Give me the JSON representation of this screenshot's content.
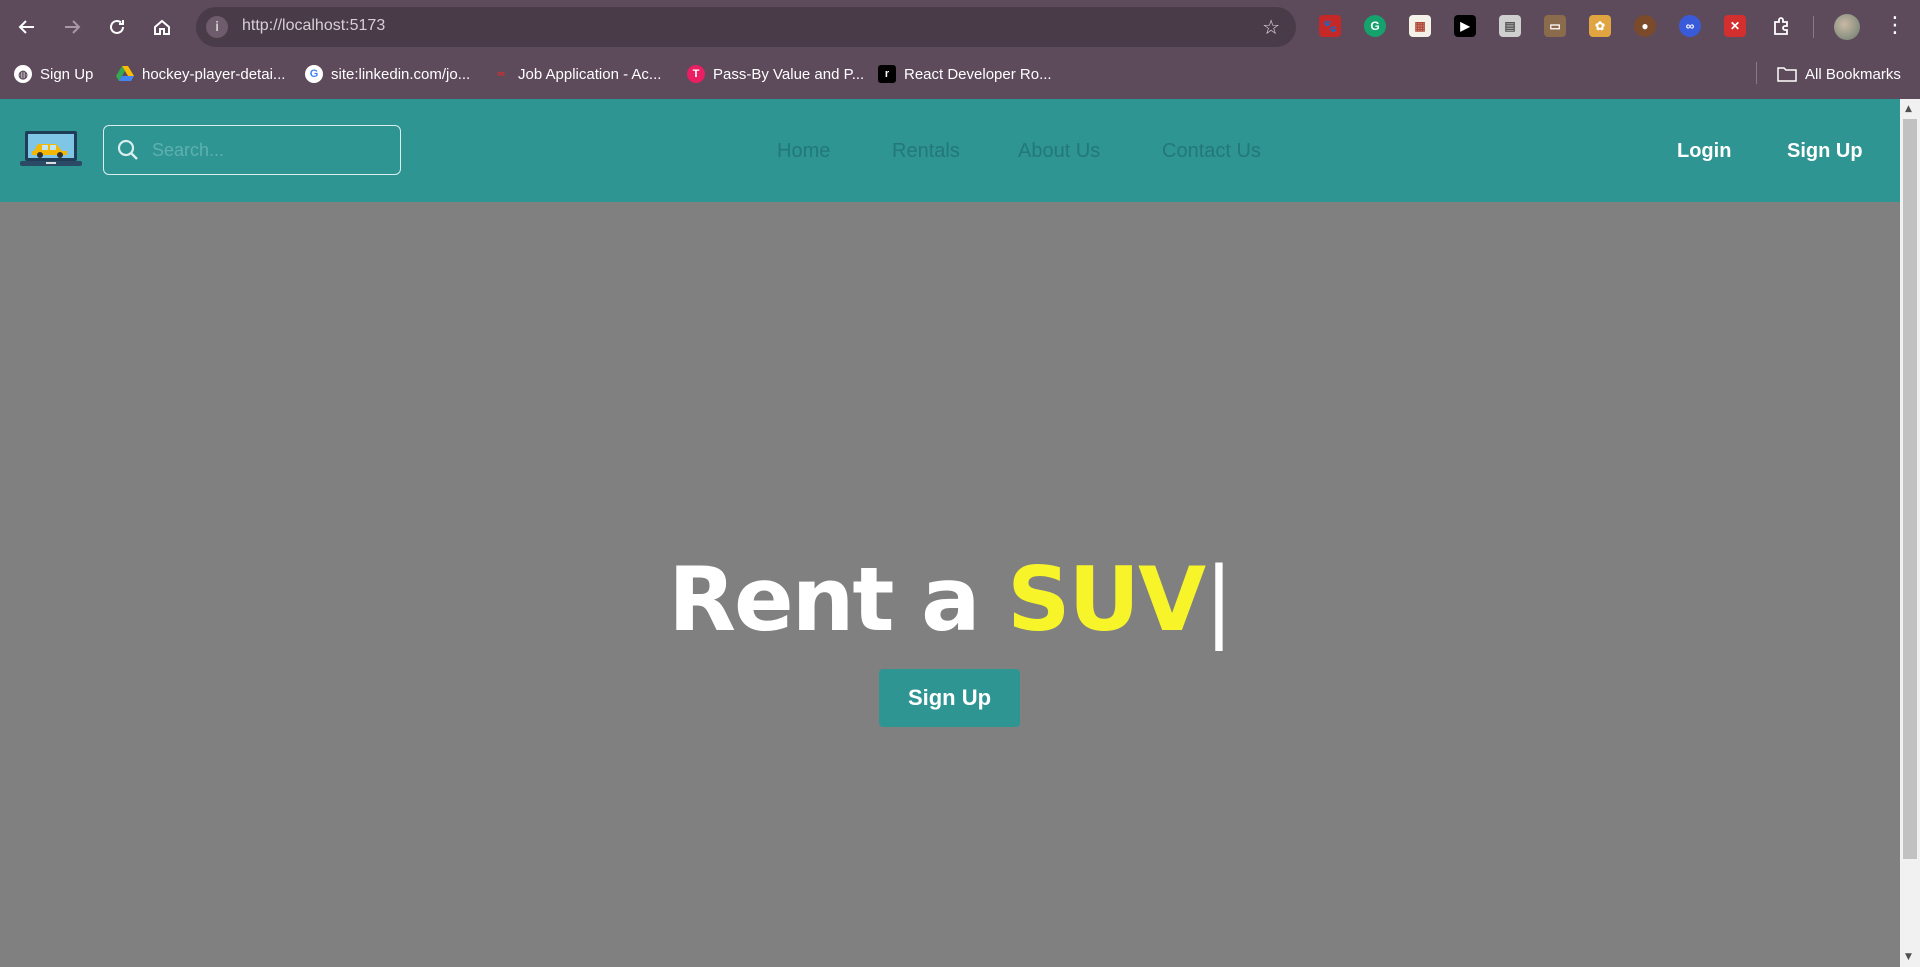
{
  "browser": {
    "url": "http://localhost:5173",
    "bookmarks": [
      {
        "label": "Sign Up",
        "icon": "globe-icon",
        "color": "#ffffff"
      },
      {
        "label": "hockey-player-detai...",
        "icon": "google-drive-icon",
        "color": "#34a853"
      },
      {
        "label": "site:linkedin.com/jo...",
        "icon": "google-icon",
        "color": "#ffffff"
      },
      {
        "label": "Job Application - Ac...",
        "icon": "acme-icon",
        "color": "#d32f2f"
      },
      {
        "label": "Pass-By Value and P...",
        "icon": "t-icon",
        "color": "#e91e63"
      },
      {
        "label": "React Developer Ro...",
        "icon": "roadmap-icon",
        "color": "#000000"
      }
    ],
    "all_bookmarks": "All Bookmarks"
  },
  "site": {
    "search_placeholder": "Search...",
    "nav": [
      "Home",
      "Rentals",
      "About Us",
      "Contact Us"
    ],
    "login": "Login",
    "signup": "Sign Up",
    "brand_color": "#2e9593"
  },
  "hero": {
    "prefix": "Rent a ",
    "highlight": "SUV",
    "cursor": "|",
    "button": "Sign Up",
    "highlight_color": "#f7f52a"
  }
}
